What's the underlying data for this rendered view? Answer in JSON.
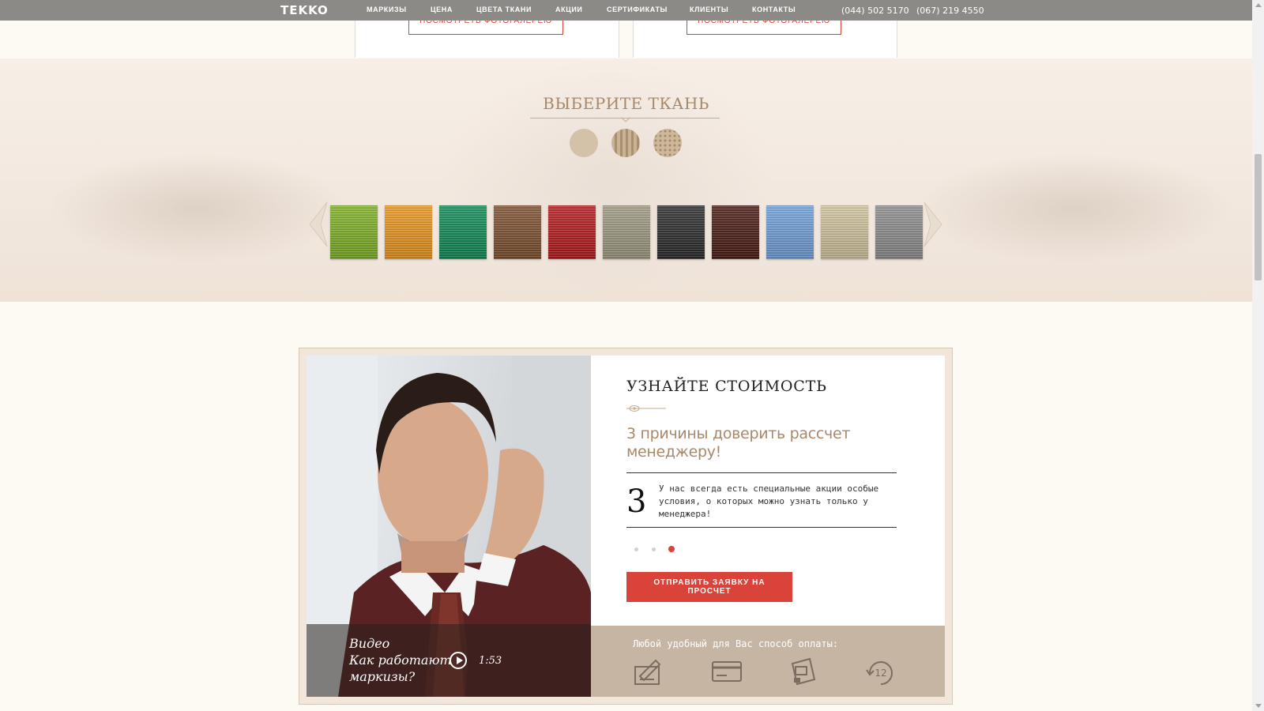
{
  "header": {
    "logo": "TEKKO",
    "nav": [
      "МАРКИЗЫ",
      "ЦЕНА",
      "ЦВЕТА ТКАНИ",
      "АКЦИИ",
      "СЕРТИФИКАТЫ",
      "КЛИЕНТЫ",
      "КОНТАКТЫ"
    ],
    "phones": [
      "(044) 502 5170",
      "(067) 219 4550"
    ]
  },
  "gallery": {
    "button_label": "ПОСМОТРЕТЬ ФОТОГАЛЕРЕЮ"
  },
  "fabric": {
    "title": "ВЫБЕРИТЕ ТКАНЬ",
    "patterns": [
      "plain",
      "striped",
      "dotted"
    ],
    "swatch_colors": [
      "#7cb024",
      "#e8951e",
      "#0f8a56",
      "#7c4f2e",
      "#b3191c",
      "#9e9880",
      "#2b2b2b",
      "#4a1a14",
      "#6f9fd8",
      "#cfc29c",
      "#8c8c8c"
    ],
    "prev_icon": "chevron-left-icon",
    "next_icon": "chevron-right-icon"
  },
  "calc": {
    "title": "УЗНАЙТЕ СТОИМОСТЬ",
    "subtitle": "3 причины доверить рассчет менеджеру!",
    "reason_number": "3",
    "reason_text": "У нас всегда есть специальные акции особые условия, о которых можно узнать только у менеджера!",
    "slides_total": 3,
    "active_slide": 3,
    "cta_label": "ОТПРАВИТЬ ЗАЯВКУ НА ПРОСЧЕТ",
    "video": {
      "text": "Видео\nКак работают\nмаркизы?",
      "duration": "1:53"
    },
    "payment": {
      "label": "Любой удобный для Вас способ оплаты:",
      "methods": [
        "invoice-icon",
        "card-icon",
        "terminal-icon",
        "installment-12-icon"
      ],
      "installment_months": "12"
    }
  },
  "colors": {
    "accent": "#d9433a",
    "beige": "#a7896a"
  }
}
